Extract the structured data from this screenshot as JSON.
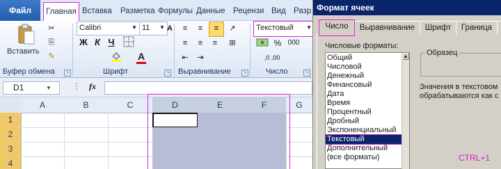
{
  "tabs": {
    "file": "Файл",
    "items": [
      "Главная",
      "Вставка",
      "Разметка",
      "Формулы",
      "Данные",
      "Рецензи",
      "Вид",
      "Разр"
    ]
  },
  "ribbon": {
    "paste_label": "Вставить",
    "clipboard_group": "Буфер обмена",
    "font_name": "Calibri",
    "font_size": "11",
    "bold": "Ж",
    "italic": "К",
    "underline": "Ч",
    "font_color_glyph": "A",
    "font_group": "Шрифт",
    "alignment_group": "Выравнивание",
    "number_format": "Текстовый",
    "number_group": "Число",
    "percent": "%",
    "thousands": "000",
    "decimals": ",0 ,00"
  },
  "formula_bar": {
    "name_box": "D1",
    "fx": "fx",
    "value": ""
  },
  "grid": {
    "columns": [
      "A",
      "B",
      "C",
      "D",
      "E",
      "F",
      "G"
    ],
    "rows": [
      "1",
      "2",
      "3",
      "4"
    ],
    "selected_columns": [
      "D",
      "E",
      "F"
    ]
  },
  "dialog": {
    "title": "Формат ячеек",
    "tabs": [
      "Число",
      "Выравнивание",
      "Шрифт",
      "Граница"
    ],
    "list_label": "Числовые форматы:",
    "formats": [
      "Общий",
      "Числовой",
      "Денежный",
      "Финансовый",
      "Дата",
      "Время",
      "Процентный",
      "Дробный",
      "Экспоненциальный",
      "Текстовый",
      "Дополнительный",
      "(все форматы)"
    ],
    "selected_format": "Текстовый",
    "sample_label": "Образец",
    "description_line1": "Значения в текстовом",
    "description_line2": "обрабатываются как с",
    "shortcut": "CTRL+1"
  },
  "colors": {
    "highlight_outline": "#e020d8",
    "selection_fill": "#b7bdd6",
    "row_header": "#f0c86a",
    "dialog_title_bar": "#0a246a",
    "file_tab": "#2a64b4",
    "shortcut_text": "#cc22cc"
  }
}
